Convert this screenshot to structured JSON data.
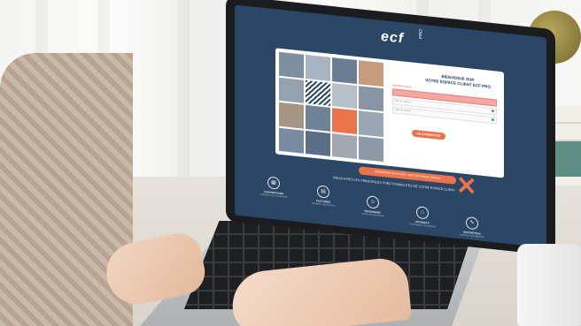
{
  "screen": {
    "logo": "ecf",
    "logo_sub": "PRO",
    "welcome_line1": "BIENVENUE SUR",
    "welcome_line2": "VOTRE ESPACE CLIENT ECF PRO",
    "id_label": "Identifiant requis",
    "password_placeholder": "Mot de passe",
    "password2_placeholder": "Mot de passe",
    "login_button": "SE CONNECTER",
    "external_button": "DEMANDER UN ACCÈS / MOT DE PASSE OUBLIÉ",
    "discover_text": "DÉCOUVREZ LES PRINCIPALES FONCTIONNALITÉS DE VOTRE ESPACE CLIENT",
    "features": [
      {
        "icon": "calendar-icon",
        "title": "CONVENTIONS",
        "desc": "Consultez vos conventions"
      },
      {
        "icon": "invoice-icon",
        "title": "FACTURES",
        "desc": "Consultez vos factures"
      },
      {
        "icon": "user-icon",
        "title": "PERSONNEL",
        "desc": "Gérez vos personnels"
      },
      {
        "icon": "cart-icon",
        "title": "PRODUITS",
        "desc": "Commandez vos produits"
      },
      {
        "icon": "badge-icon",
        "title": "INSCRIPTION",
        "desc": "Inscrivez vos stagiaires"
      }
    ]
  },
  "colors": {
    "screen_bg": "#2c4766",
    "accent": "#e9734a",
    "error_field": "#f5a7a4"
  }
}
